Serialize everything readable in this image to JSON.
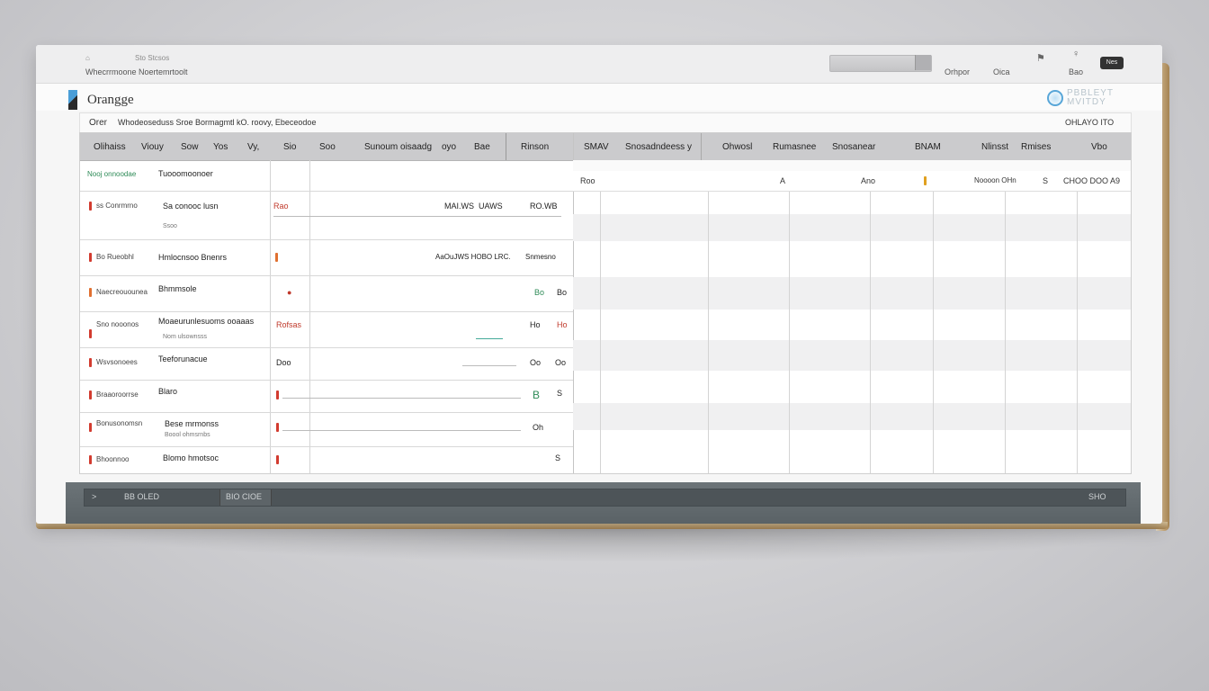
{
  "window": {
    "app_title": "Orangge",
    "chrome": {
      "top_left_labels": [
        "Whecrrmoone Noertemrtoolt"
      ],
      "tiny_labels": [
        "⌂",
        "Sto Stcsos"
      ],
      "nav_right": [
        "Orhpor",
        "Oica",
        "Bao"
      ],
      "pill": "Nes"
    },
    "brand": "PBBLEYT\nMVITDY",
    "toolbar": {
      "left_label": "Orer",
      "crumbs": "Whodeoseduss Sroe Bormagmtl kO. roovy, Ebeceodoe",
      "right_label": "OHLAYO ITO"
    },
    "columns": [
      "Olihaiss",
      "Viouy",
      "Sow",
      "Yos",
      "Vy,",
      "Sio",
      "Soo",
      "Sunoum oisaadg",
      "oyo",
      "Bae",
      "Rinson",
      "SMAV",
      "Snosadndeess y",
      "Ohwosl",
      "Rumasnee",
      "Snosanear",
      "BNAM",
      "Nlinsst",
      "Rmises",
      "Vbo"
    ],
    "rows": [
      {
        "label": "Nooj onnoodae",
        "name": "Tuooomoonoer",
        "sub": "",
        "vals": []
      },
      {
        "label": "ss Conrmrno",
        "name": "Sa conooc lusn",
        "sub": "Ssoo",
        "vals": [
          "Rao",
          "MAI.WS",
          "UAWS",
          "RO.WB"
        ]
      },
      {
        "label": "Bo Rueobhl",
        "name": "Hmlocnsoo Bnenrs",
        "sub": "",
        "vals": [
          "AaOuJWS HOBO LRC.",
          "Snmesno"
        ]
      },
      {
        "label": "Naecreouounea",
        "name": "Bhmmsole",
        "sub": "",
        "vals": [
          "Bo",
          "Bo"
        ]
      },
      {
        "label": "Sno nooonos",
        "name": "Moaeurunlesuoms ooaaas",
        "sub": "Nom ulsownsss",
        "vals": [
          "Rofsas",
          "Ho",
          "Ho"
        ]
      },
      {
        "label": "Wsvsonoees",
        "name": "Teeforunacue",
        "sub": "",
        "vals": [
          "Doo",
          "Oo",
          "Oo"
        ]
      },
      {
        "label": "Braaoroorrse",
        "name": "Blaro",
        "sub": "",
        "vals": [
          "B",
          "S"
        ]
      },
      {
        "label": "Bonusonomsn",
        "name": "Bese mrmonss",
        "sub": "Boool ohmsrnbs",
        "vals": [
          "Oh"
        ]
      },
      {
        "label": "Bhoonnoo",
        "name": "Blomo hmotsoc",
        "sub": "",
        "vals": [
          "S"
        ]
      }
    ],
    "right_row": {
      "lead": "Roo",
      "values": [
        "A",
        "Ano",
        "Noooon OHn",
        "S",
        "CHOO DOO A9"
      ]
    },
    "footer": {
      "left": ">",
      "label1": "BB OLED",
      "label2": "BIO CIOE",
      "right": "SHO"
    }
  }
}
